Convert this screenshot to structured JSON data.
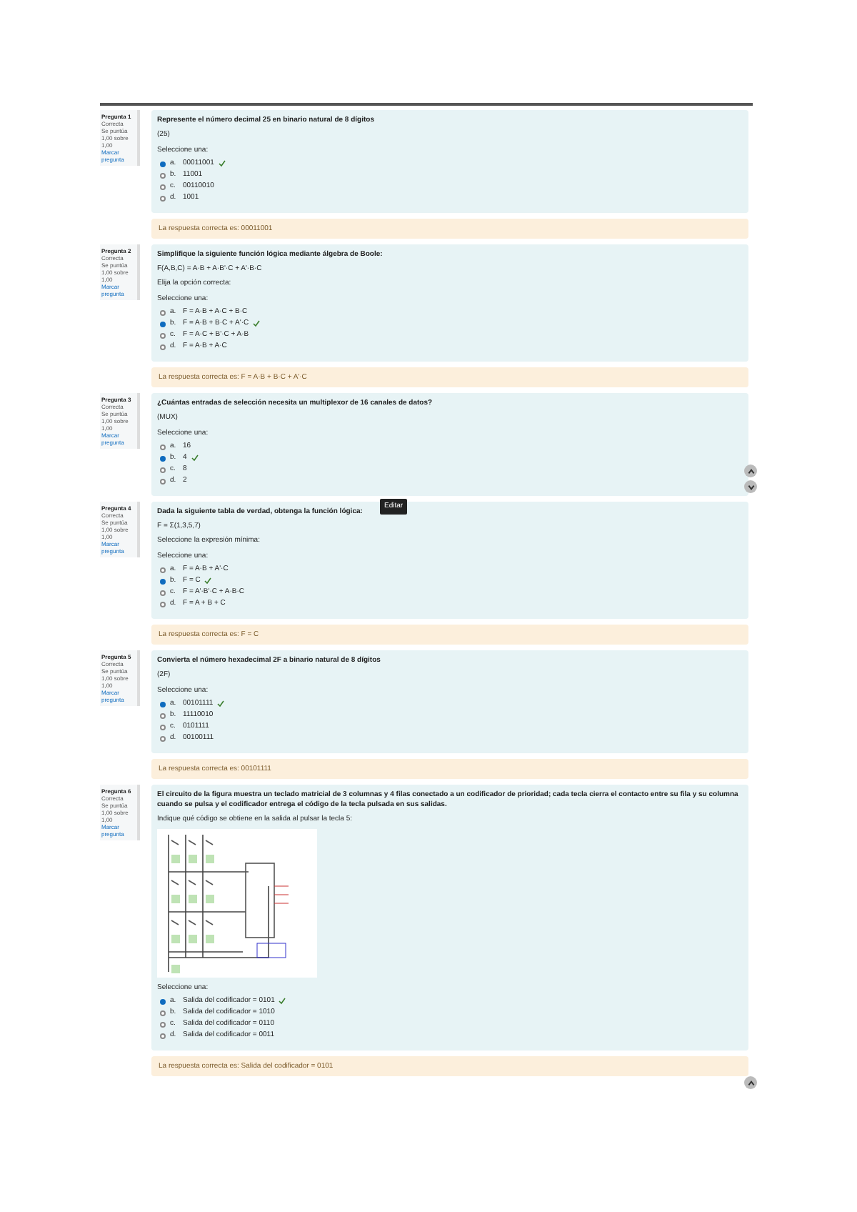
{
  "questions": [
    {
      "info": [
        "Pregunta 1",
        "Correcta",
        "Se puntúa 1,00 sobre 1,00",
        "Marcar pregunta"
      ],
      "text": [
        "Represente el número decimal 25 en binario natural de 8 dígitos",
        "(25)"
      ],
      "prompt": "Seleccione una:",
      "options": [
        {
          "label": "a.",
          "text": "00011001",
          "selected": true
        },
        {
          "label": "b.",
          "text": "11001",
          "selected": false
        },
        {
          "label": "c.",
          "text": "00110010",
          "selected": false
        },
        {
          "label": "d.",
          "text": "1001",
          "selected": false
        }
      ],
      "feedback": "La respuesta correcta es: 00011001"
    },
    {
      "info": [
        "Pregunta 2",
        "Correcta",
        "Se puntúa 1,00 sobre 1,00",
        "Marcar pregunta"
      ],
      "text": [
        "Simplifique la siguiente función lógica mediante álgebra de Boole:",
        "F(A,B,C) = A·B + A·B'·C + A'·B·C",
        "Elija la opción correcta:"
      ],
      "prompt": "Seleccione una:",
      "options": [
        {
          "label": "a.",
          "text": "F = A·B + A·C + B·C",
          "selected": false
        },
        {
          "label": "b.",
          "text": "F = A·B + B·C + A'·C",
          "selected": true
        },
        {
          "label": "c.",
          "text": "F = A·C + B'·C + A·B",
          "selected": false
        },
        {
          "label": "d.",
          "text": "F = A·B + A·C",
          "selected": false
        }
      ],
      "feedback": "La respuesta correcta es: F = A·B + B·C + A'·C"
    },
    {
      "info": [
        "Pregunta 3",
        "Correcta",
        "Se puntúa 1,00 sobre 1,00",
        "Marcar pregunta"
      ],
      "text": [
        "¿Cuántas entradas de selección necesita un multiplexor de 16 canales de datos?",
        "(MUX)"
      ],
      "prompt": "Seleccione una:",
      "options": [
        {
          "label": "a.",
          "text": "16",
          "selected": false
        },
        {
          "label": "b.",
          "text": "4",
          "selected": true
        },
        {
          "label": "c.",
          "text": "8",
          "selected": false
        },
        {
          "label": "d.",
          "text": "2",
          "selected": false
        }
      ]
    },
    {
      "info": [
        "Pregunta 4",
        "Correcta",
        "Se puntúa 1,00 sobre 1,00",
        "Marcar pregunta"
      ],
      "tooltip": "Editar",
      "text": [
        "Dada la siguiente tabla de verdad, obtenga la función lógica:",
        "F = Σ(1,3,5,7)",
        "Seleccione la expresión mínima:"
      ],
      "prompt": "Seleccione una:",
      "options": [
        {
          "label": "a.",
          "text": "F = A·B + A'·C",
          "selected": false
        },
        {
          "label": "b.",
          "text": "F = C",
          "selected": true
        },
        {
          "label": "c.",
          "text": "F = A'·B'·C + A·B·C",
          "selected": false
        },
        {
          "label": "d.",
          "text": "F = A + B + C",
          "selected": false
        }
      ],
      "feedback": "La respuesta correcta es: F = C"
    },
    {
      "info": [
        "Pregunta 5",
        "Correcta",
        "Se puntúa 1,00 sobre 1,00",
        "Marcar pregunta"
      ],
      "text": [
        "Convierta el número hexadecimal 2F a binario natural de 8 dígitos",
        "(2F)"
      ],
      "prompt": "Seleccione una:",
      "options": [
        {
          "label": "a.",
          "text": "00101111",
          "selected": true
        },
        {
          "label": "b.",
          "text": "11110010",
          "selected": false
        },
        {
          "label": "c.",
          "text": "0101111",
          "selected": false
        },
        {
          "label": "d.",
          "text": "00100111",
          "selected": false
        }
      ],
      "feedback": "La respuesta correcta es: 00101111"
    },
    {
      "info": [
        "Pregunta 6",
        "Correcta",
        "Se puntúa 1,00 sobre 1,00",
        "Marcar pregunta"
      ],
      "text": [
        "El circuito de la figura muestra un teclado matricial de 3 columnas y 4 filas conectado a un codificador de prioridad; cada tecla cierra el contacto entre su fila y su columna cuando se pulsa y el codificador entrega el código de la tecla pulsada en sus salidas.",
        "Indique qué código se obtiene en la salida al pulsar la tecla 5:"
      ],
      "figure": true,
      "prompt": "Seleccione una:",
      "options": [
        {
          "label": "a.",
          "text": "Salida del codificador = 0101",
          "selected": true
        },
        {
          "label": "b.",
          "text": "Salida del codificador = 1010",
          "selected": false
        },
        {
          "label": "c.",
          "text": "Salida del codificador = 0110",
          "selected": false
        },
        {
          "label": "d.",
          "text": "Salida del codificador = 0011",
          "selected": false
        }
      ],
      "feedback": "La respuesta correcta es: Salida del codificador = 0101"
    }
  ]
}
